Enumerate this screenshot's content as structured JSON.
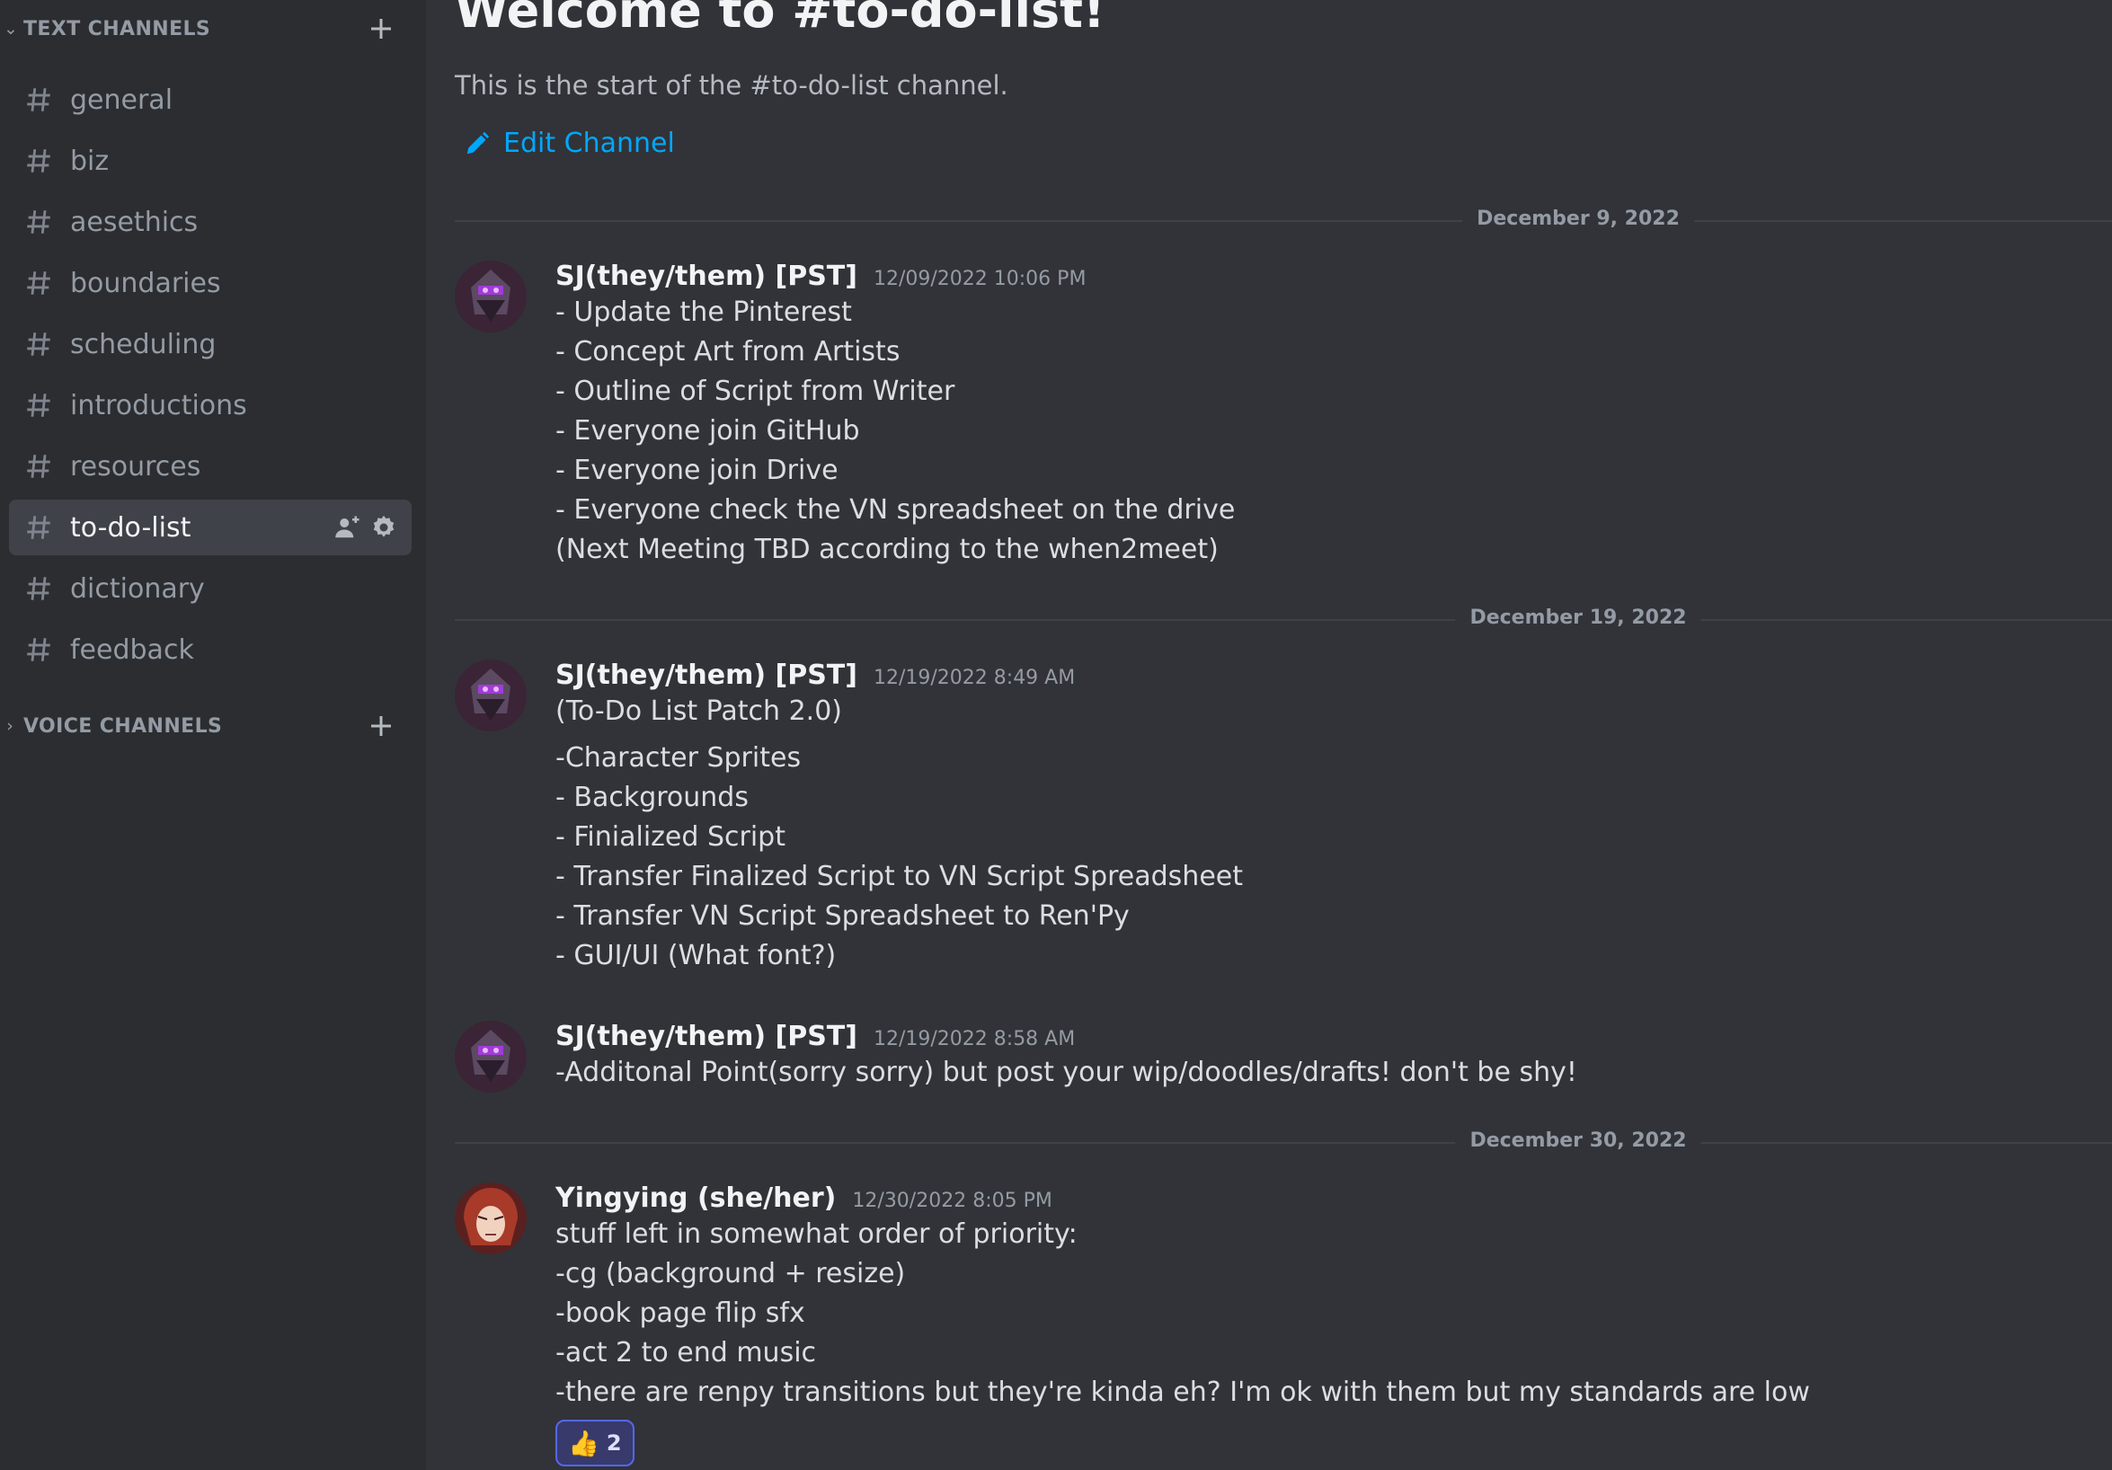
{
  "sidebar": {
    "text_category": {
      "label": "TEXT CHANNELS",
      "icon": "chevron-down-icon"
    },
    "channels": [
      {
        "name": "general",
        "icon": "hash-icon"
      },
      {
        "name": "biz",
        "icon": "hash-icon"
      },
      {
        "name": "aesethics",
        "icon": "hash-icon"
      },
      {
        "name": "boundaries",
        "icon": "hash-icon"
      },
      {
        "name": "scheduling",
        "icon": "hash-icon"
      },
      {
        "name": "introductions",
        "icon": "hash-icon"
      },
      {
        "name": "resources",
        "icon": "hash-icon"
      },
      {
        "name": "to-do-list",
        "icon": "hash-icon",
        "active": true
      },
      {
        "name": "dictionary",
        "icon": "hash-icon"
      },
      {
        "name": "feedback",
        "icon": "hash-icon"
      }
    ],
    "voice_category": {
      "label": "VOICE CHANNELS",
      "icon": "chevron-right-icon"
    }
  },
  "main": {
    "welcome_title": "Welcome to #to-do-list!",
    "welcome_subtitle": "This is the start of the #to-do-list channel.",
    "edit_channel_label": "Edit Channel",
    "dividers": [
      "December 9, 2022",
      "December 19, 2022",
      "December 30, 2022"
    ],
    "messages": [
      {
        "author": "SJ(they/them) [PST]",
        "timestamp": "12/09/2022 10:06 PM",
        "lines": [
          "- Update the Pinterest",
          "- Concept Art from Artists",
          "- Outline of Script from Writer",
          "- Everyone join GitHub",
          "- Everyone join Drive",
          "- Everyone check the VN spreadsheet on the drive",
          "(Next Meeting TBD according to the when2meet)"
        ]
      },
      {
        "author": "SJ(they/them) [PST]",
        "timestamp": "12/19/2022 8:49 AM",
        "header_line": "(To-Do List Patch 2.0)",
        "lines": [
          "-Character Sprites",
          "- Backgrounds",
          "- Finialized Script",
          "- Transfer Finalized Script to VN Script Spreadsheet",
          "- Transfer VN Script Spreadsheet to Ren'Py",
          "- GUI/UI (What font?)"
        ]
      },
      {
        "author": "SJ(they/them) [PST]",
        "timestamp": "12/19/2022 8:58 AM",
        "lines": [
          "-Additonal Point(sorry sorry) but post your wip/doodles/drafts! don't be shy!"
        ]
      },
      {
        "author": "Yingying (she/her)",
        "timestamp": "12/30/2022 8:05 PM",
        "lines": [
          "stuff left in somewhat order of priority:",
          "-cg (background + resize)",
          "-book page flip sfx",
          "-act 2 to end music",
          "-there are renpy transitions but they're kinda eh? I'm ok with them but my standards are low"
        ],
        "reaction": {
          "emoji": "👍",
          "count": "2"
        }
      }
    ]
  },
  "colors": {
    "sidebar_bg": "#2b2d31",
    "main_bg": "#313338",
    "active_channel_bg": "#404249",
    "link": "#00a8fc",
    "reaction_border": "#5865f2"
  }
}
